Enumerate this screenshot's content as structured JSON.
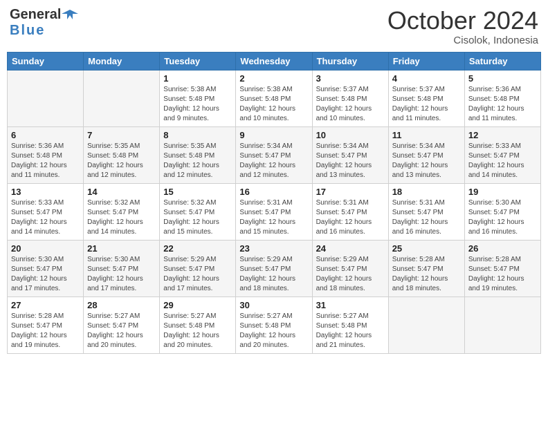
{
  "header": {
    "logo_general": "General",
    "logo_blue": "Blue",
    "month_title": "October 2024",
    "location": "Cisolok, Indonesia"
  },
  "days_of_week": [
    "Sunday",
    "Monday",
    "Tuesday",
    "Wednesday",
    "Thursday",
    "Friday",
    "Saturday"
  ],
  "weeks": [
    [
      {
        "day": "",
        "info": ""
      },
      {
        "day": "",
        "info": ""
      },
      {
        "day": "1",
        "sunrise": "Sunrise: 5:38 AM",
        "sunset": "Sunset: 5:48 PM",
        "daylight": "Daylight: 12 hours and 9 minutes."
      },
      {
        "day": "2",
        "sunrise": "Sunrise: 5:38 AM",
        "sunset": "Sunset: 5:48 PM",
        "daylight": "Daylight: 12 hours and 10 minutes."
      },
      {
        "day": "3",
        "sunrise": "Sunrise: 5:37 AM",
        "sunset": "Sunset: 5:48 PM",
        "daylight": "Daylight: 12 hours and 10 minutes."
      },
      {
        "day": "4",
        "sunrise": "Sunrise: 5:37 AM",
        "sunset": "Sunset: 5:48 PM",
        "daylight": "Daylight: 12 hours and 11 minutes."
      },
      {
        "day": "5",
        "sunrise": "Sunrise: 5:36 AM",
        "sunset": "Sunset: 5:48 PM",
        "daylight": "Daylight: 12 hours and 11 minutes."
      }
    ],
    [
      {
        "day": "6",
        "sunrise": "Sunrise: 5:36 AM",
        "sunset": "Sunset: 5:48 PM",
        "daylight": "Daylight: 12 hours and 11 minutes."
      },
      {
        "day": "7",
        "sunrise": "Sunrise: 5:35 AM",
        "sunset": "Sunset: 5:48 PM",
        "daylight": "Daylight: 12 hours and 12 minutes."
      },
      {
        "day": "8",
        "sunrise": "Sunrise: 5:35 AM",
        "sunset": "Sunset: 5:48 PM",
        "daylight": "Daylight: 12 hours and 12 minutes."
      },
      {
        "day": "9",
        "sunrise": "Sunrise: 5:34 AM",
        "sunset": "Sunset: 5:47 PM",
        "daylight": "Daylight: 12 hours and 12 minutes."
      },
      {
        "day": "10",
        "sunrise": "Sunrise: 5:34 AM",
        "sunset": "Sunset: 5:47 PM",
        "daylight": "Daylight: 12 hours and 13 minutes."
      },
      {
        "day": "11",
        "sunrise": "Sunrise: 5:34 AM",
        "sunset": "Sunset: 5:47 PM",
        "daylight": "Daylight: 12 hours and 13 minutes."
      },
      {
        "day": "12",
        "sunrise": "Sunrise: 5:33 AM",
        "sunset": "Sunset: 5:47 PM",
        "daylight": "Daylight: 12 hours and 14 minutes."
      }
    ],
    [
      {
        "day": "13",
        "sunrise": "Sunrise: 5:33 AM",
        "sunset": "Sunset: 5:47 PM",
        "daylight": "Daylight: 12 hours and 14 minutes."
      },
      {
        "day": "14",
        "sunrise": "Sunrise: 5:32 AM",
        "sunset": "Sunset: 5:47 PM",
        "daylight": "Daylight: 12 hours and 14 minutes."
      },
      {
        "day": "15",
        "sunrise": "Sunrise: 5:32 AM",
        "sunset": "Sunset: 5:47 PM",
        "daylight": "Daylight: 12 hours and 15 minutes."
      },
      {
        "day": "16",
        "sunrise": "Sunrise: 5:31 AM",
        "sunset": "Sunset: 5:47 PM",
        "daylight": "Daylight: 12 hours and 15 minutes."
      },
      {
        "day": "17",
        "sunrise": "Sunrise: 5:31 AM",
        "sunset": "Sunset: 5:47 PM",
        "daylight": "Daylight: 12 hours and 16 minutes."
      },
      {
        "day": "18",
        "sunrise": "Sunrise: 5:31 AM",
        "sunset": "Sunset: 5:47 PM",
        "daylight": "Daylight: 12 hours and 16 minutes."
      },
      {
        "day": "19",
        "sunrise": "Sunrise: 5:30 AM",
        "sunset": "Sunset: 5:47 PM",
        "daylight": "Daylight: 12 hours and 16 minutes."
      }
    ],
    [
      {
        "day": "20",
        "sunrise": "Sunrise: 5:30 AM",
        "sunset": "Sunset: 5:47 PM",
        "daylight": "Daylight: 12 hours and 17 minutes."
      },
      {
        "day": "21",
        "sunrise": "Sunrise: 5:30 AM",
        "sunset": "Sunset: 5:47 PM",
        "daylight": "Daylight: 12 hours and 17 minutes."
      },
      {
        "day": "22",
        "sunrise": "Sunrise: 5:29 AM",
        "sunset": "Sunset: 5:47 PM",
        "daylight": "Daylight: 12 hours and 17 minutes."
      },
      {
        "day": "23",
        "sunrise": "Sunrise: 5:29 AM",
        "sunset": "Sunset: 5:47 PM",
        "daylight": "Daylight: 12 hours and 18 minutes."
      },
      {
        "day": "24",
        "sunrise": "Sunrise: 5:29 AM",
        "sunset": "Sunset: 5:47 PM",
        "daylight": "Daylight: 12 hours and 18 minutes."
      },
      {
        "day": "25",
        "sunrise": "Sunrise: 5:28 AM",
        "sunset": "Sunset: 5:47 PM",
        "daylight": "Daylight: 12 hours and 18 minutes."
      },
      {
        "day": "26",
        "sunrise": "Sunrise: 5:28 AM",
        "sunset": "Sunset: 5:47 PM",
        "daylight": "Daylight: 12 hours and 19 minutes."
      }
    ],
    [
      {
        "day": "27",
        "sunrise": "Sunrise: 5:28 AM",
        "sunset": "Sunset: 5:47 PM",
        "daylight": "Daylight: 12 hours and 19 minutes."
      },
      {
        "day": "28",
        "sunrise": "Sunrise: 5:27 AM",
        "sunset": "Sunset: 5:47 PM",
        "daylight": "Daylight: 12 hours and 20 minutes."
      },
      {
        "day": "29",
        "sunrise": "Sunrise: 5:27 AM",
        "sunset": "Sunset: 5:48 PM",
        "daylight": "Daylight: 12 hours and 20 minutes."
      },
      {
        "day": "30",
        "sunrise": "Sunrise: 5:27 AM",
        "sunset": "Sunset: 5:48 PM",
        "daylight": "Daylight: 12 hours and 20 minutes."
      },
      {
        "day": "31",
        "sunrise": "Sunrise: 5:27 AM",
        "sunset": "Sunset: 5:48 PM",
        "daylight": "Daylight: 12 hours and 21 minutes."
      },
      {
        "day": "",
        "info": ""
      },
      {
        "day": "",
        "info": ""
      }
    ]
  ]
}
